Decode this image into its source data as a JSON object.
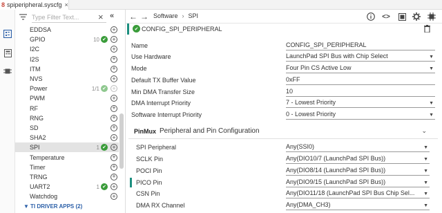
{
  "tab": {
    "title": "spiperipheral.syscfg",
    "icon": "8",
    "close": "×"
  },
  "sidebar": {
    "filter_placeholder": "Type Filter Text...",
    "items": [
      {
        "name": "EDDSA",
        "count": "",
        "check": false
      },
      {
        "name": "GPIO",
        "count": "10",
        "check": true
      },
      {
        "name": "I2C",
        "count": "",
        "check": false
      },
      {
        "name": "I2S",
        "count": "",
        "check": false
      },
      {
        "name": "ITM",
        "count": "",
        "check": false
      },
      {
        "name": "NVS",
        "count": "",
        "check": false
      },
      {
        "name": "Power",
        "count": "1/1",
        "check": true,
        "dim": true
      },
      {
        "name": "PWM",
        "count": "",
        "check": false
      },
      {
        "name": "RF",
        "count": "",
        "check": false
      },
      {
        "name": "RNG",
        "count": "",
        "check": false
      },
      {
        "name": "SD",
        "count": "",
        "check": false
      },
      {
        "name": "SHA2",
        "count": "",
        "check": false
      },
      {
        "name": "SPI",
        "count": "1",
        "check": true,
        "selected": true
      },
      {
        "name": "Temperature",
        "count": "",
        "check": false
      },
      {
        "name": "Timer",
        "count": "",
        "check": false
      },
      {
        "name": "TRNG",
        "count": "",
        "check": false
      },
      {
        "name": "UART2",
        "count": "1",
        "check": true
      },
      {
        "name": "Watchdog",
        "count": "",
        "check": false
      }
    ],
    "group": "TI DRIVER APPS (2)"
  },
  "toolbar": {
    "crumb1": "Software",
    "sep": "›",
    "crumb2": "SPI"
  },
  "instance": {
    "name": "CONFIG_SPI_PERIPHERAL"
  },
  "properties": [
    {
      "label": "Name",
      "value": "CONFIG_SPI_PERIPHERAL",
      "dropdown": false
    },
    {
      "label": "Use Hardware",
      "value": "LaunchPad SPI Bus with Chip Select",
      "dropdown": true
    },
    {
      "label": "Mode",
      "value": "Four Pin CS Active Low",
      "dropdown": true
    },
    {
      "label": "Default TX Buffer Value",
      "value": "0xFF",
      "dropdown": false
    },
    {
      "label": "Min DMA Transfer Size",
      "value": "10",
      "dropdown": false
    },
    {
      "label": "DMA Interrupt Priority",
      "value": "7 - Lowest Priority",
      "dropdown": true
    },
    {
      "label": "Software Interrupt Priority",
      "value": "0 - Lowest Priority",
      "dropdown": true
    }
  ],
  "pinmux": {
    "tag": "PinMux",
    "title": "Peripheral and Pin Configuration",
    "pins": [
      {
        "label": "SPI Peripheral",
        "value": "Any(SSI0)",
        "marked": false
      },
      {
        "label": "SCLK Pin",
        "value": "Any(DIO10/7 (LaunchPad SPI Bus))",
        "marked": false
      },
      {
        "label": "POCI Pin",
        "value": "Any(DIO8/14 (LaunchPad SPI Bus))",
        "marked": false
      },
      {
        "label": "PICO Pin",
        "value": "Any(DIO9/15 (LaunchPad SPI Bus))",
        "marked": true
      },
      {
        "label": "CSN Pin",
        "value": "Any(DIO11/18 (LaunchPad SPI Bus Chip Sel...",
        "marked": false
      },
      {
        "label": "DMA RX Channel",
        "value": "Any(DMA_CH3)",
        "marked": false
      }
    ]
  },
  "colors": {
    "accent": "#1c8f7f",
    "check": "#3a9c3a",
    "group": "#2b5fa8"
  }
}
